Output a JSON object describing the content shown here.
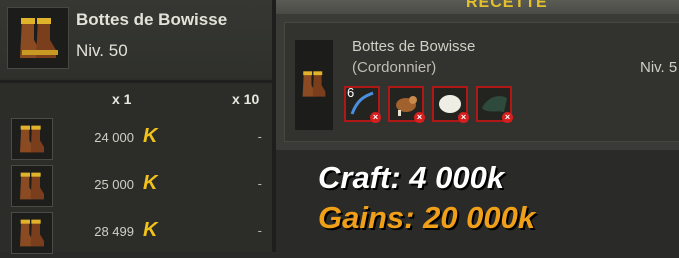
{
  "item": {
    "name": "Bottes de Bowisse",
    "level": "Niv. 50",
    "icon": "boots-icon"
  },
  "table": {
    "col1": "x 1",
    "col2": "x 10",
    "rows": [
      {
        "price": "24 000",
        "x10": "-"
      },
      {
        "price": "25 000",
        "x10": "-"
      },
      {
        "price": "28 499",
        "x10": "-"
      }
    ],
    "currency_icon": "kama-icon"
  },
  "recipe": {
    "header": "RECETTE",
    "name": "Bottes de Bowisse",
    "job": "(Cordonnier)",
    "level": "Niv. 5",
    "ingredients": [
      {
        "icon": "blue-thread-icon",
        "qty": "6"
      },
      {
        "icon": "bird-icon",
        "qty": ""
      },
      {
        "icon": "egg-icon",
        "qty": ""
      },
      {
        "icon": "green-leather-icon",
        "qty": ""
      }
    ]
  },
  "overlay": {
    "craft": "Craft: 4 000k",
    "gains": "Gains: 20 000k"
  },
  "colors": {
    "gold": "#e6c02a",
    "gains_orange": "#f0a018",
    "missing_red": "#d61e1e"
  }
}
